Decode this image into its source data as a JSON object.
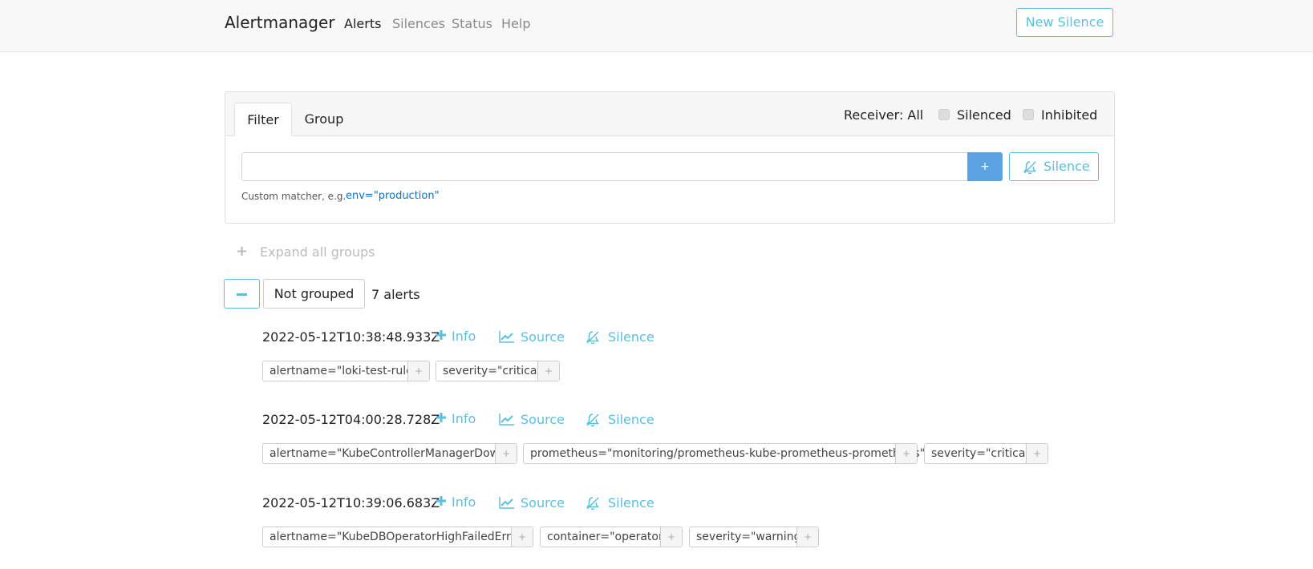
{
  "nav": {
    "brand": "Alertmanager",
    "links": [
      "Alerts",
      "Silences",
      "Status",
      "Help"
    ],
    "new_silence": "New Silence"
  },
  "filter": {
    "tabs": [
      "Filter",
      "Group"
    ],
    "receiver": "Receiver: All",
    "silenced": "Silenced",
    "inhibited": "Inhibited",
    "input_value": "",
    "add_button": "+",
    "silence_button": "Silence",
    "hint": "Custom matcher, e.g.",
    "hint_example": "env=\"production\""
  },
  "expand_all": "Expand all groups",
  "group": {
    "label": "Not grouped",
    "count": "7 alerts"
  },
  "actions": {
    "info": "Info",
    "source": "Source",
    "silence": "Silence"
  },
  "alerts": [
    {
      "timestamp": "2022-05-12T10:38:48.933Z",
      "labels": [
        "alertname=\"loki-test-rule\"",
        "severity=\"critical\""
      ]
    },
    {
      "timestamp": "2022-05-12T04:00:28.728Z",
      "labels": [
        "alertname=\"KubeControllerManagerDown\"",
        "prometheus=\"monitoring/prometheus-kube-prometheus-prometheus\"",
        "severity=\"critical\""
      ]
    },
    {
      "timestamp": "2022-05-12T10:39:06.683Z",
      "labels": [
        "alertname=\"KubeDBOperatorHighFailedError\"",
        "container=\"operator\"",
        "severity=\"warning\""
      ]
    }
  ],
  "label_plus": "+",
  "colors": {
    "accent": "#5bc0de",
    "primary": "#5aa3e0",
    "link": "#0275d8"
  }
}
